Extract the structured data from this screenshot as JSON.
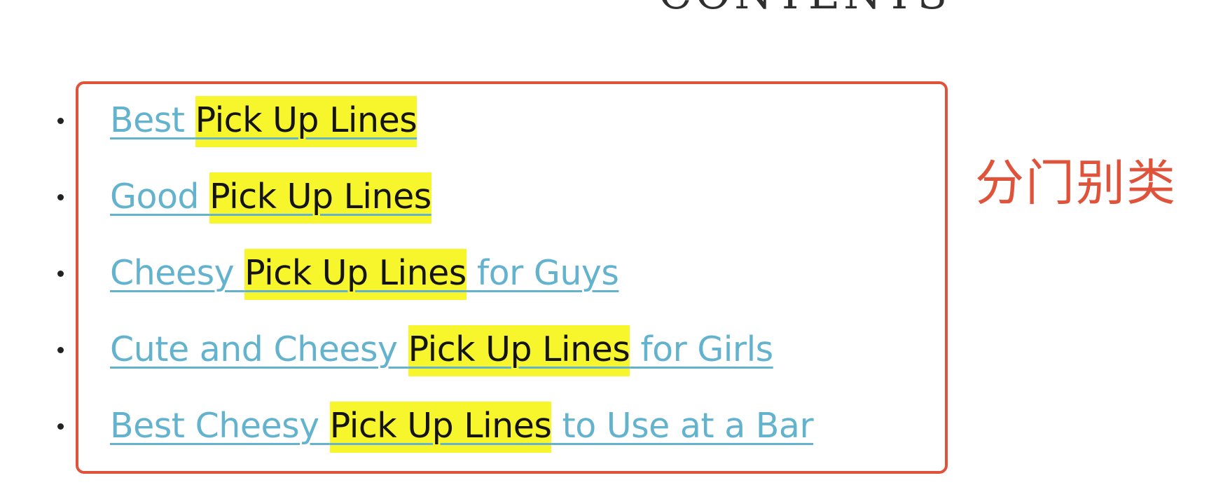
{
  "heading": "CONTENTS",
  "annotation": "分门别类",
  "colors": {
    "box_border": "#e0533b",
    "link": "#63b3cf",
    "highlight": "#f7f52c",
    "annotation": "#e0533b"
  },
  "toc": {
    "items": [
      {
        "prefix": "Best ",
        "highlight": "Pick Up Lines",
        "suffix": ""
      },
      {
        "prefix": "Good ",
        "highlight": "Pick Up Lines",
        "suffix": ""
      },
      {
        "prefix": "Cheesy ",
        "highlight": "Pick Up Lines",
        "suffix": " for Guys"
      },
      {
        "prefix": "Cute and Cheesy ",
        "highlight": "Pick Up Lines",
        "suffix": " for Girls"
      },
      {
        "prefix": "Best Cheesy ",
        "highlight": "Pick Up Lines",
        "suffix": " to Use at a Bar"
      }
    ]
  }
}
